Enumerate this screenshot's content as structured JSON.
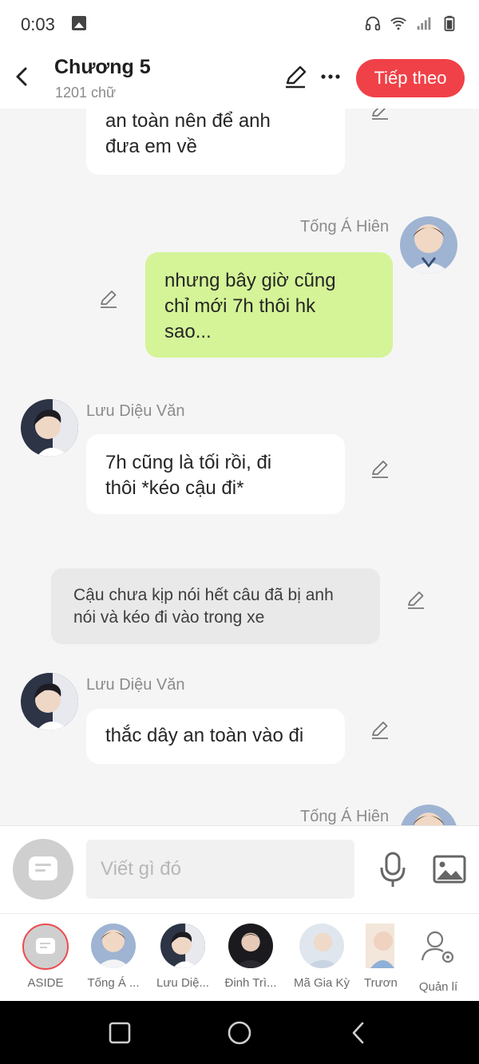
{
  "status_bar": {
    "time": "0:03",
    "icons": [
      "gallery-icon",
      "headphones-icon",
      "wifi-icon",
      "signal-icon",
      "battery-icon"
    ]
  },
  "header": {
    "title": "Chương 5",
    "word_count": "1201 chữ",
    "next_label": "Tiếp theo",
    "accent_color": "#f04148"
  },
  "chat": {
    "messages": [
      {
        "kind": "left",
        "text_lines": [
          "an toàn nên để anh",
          "đưa em về"
        ]
      },
      {
        "kind": "right",
        "speaker": "Tống Á Hiên",
        "text_lines": [
          "nhưng bây giờ cũng",
          "chỉ mới 7h thôi hk",
          "sao..."
        ],
        "bubble_color": "#d4f497"
      },
      {
        "kind": "left",
        "speaker": "Lưu Diệu Văn",
        "text_lines": [
          "7h cũng là tối rồi, đi",
          "thôi *kéo cậu đi*"
        ]
      },
      {
        "kind": "narration",
        "text_lines": [
          "Cậu chưa kịp nói hết câu đã bị anh",
          "nói và kéo đi vào trong xe"
        ]
      },
      {
        "kind": "left",
        "speaker": "Lưu Diệu Văn",
        "text_lines": [
          "thắc dây an toàn vào đi"
        ]
      },
      {
        "kind": "right",
        "speaker": "Tống Á Hiên"
      }
    ]
  },
  "composer": {
    "placeholder": "Viết gì đó"
  },
  "characters": [
    {
      "name": "ASIDE",
      "selected": true
    },
    {
      "name": "Tống Á ..."
    },
    {
      "name": "Lưu Diệ..."
    },
    {
      "name": "Đinh Trì..."
    },
    {
      "name": "Mã Gia Kỳ"
    },
    {
      "name": "Trươn"
    },
    {
      "name": "Quản lí"
    }
  ]
}
